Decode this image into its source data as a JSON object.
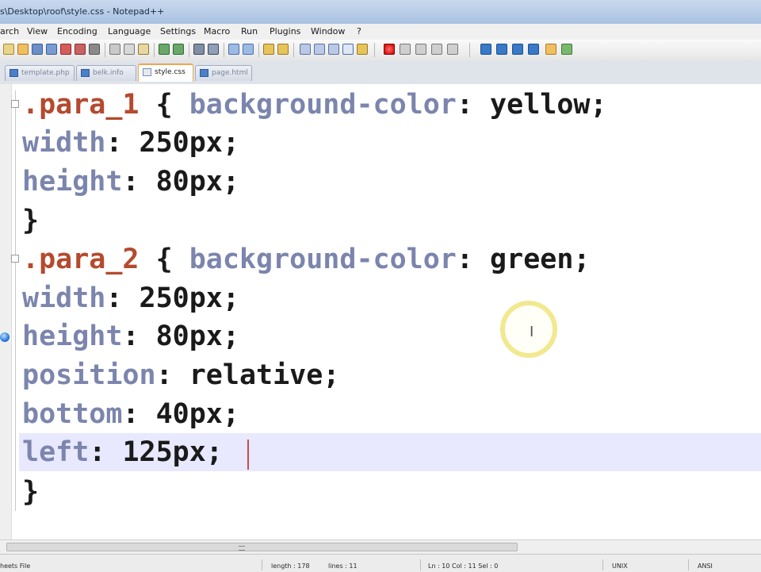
{
  "window": {
    "title": "s\\Desktop\\roof\\style.css - Notepad++"
  },
  "menubar": {
    "items": [
      "arch",
      "View",
      "Encoding",
      "Language",
      "Settings",
      "Macro",
      "Run",
      "Plugins",
      "Window",
      "?"
    ]
  },
  "tabs": [
    {
      "label": "template.php",
      "active": false
    },
    {
      "label": "belk.info",
      "active": false
    },
    {
      "label": "style.css",
      "active": true
    },
    {
      "label": "page.html",
      "active": false
    }
  ],
  "editor": {
    "lines": [
      {
        "sel": ".para_1",
        "open": " { ",
        "prop": "background-color",
        "colon": ": ",
        "val": "yellow",
        "end": ";"
      },
      {
        "prop": "width",
        "colon": ": ",
        "val": "250px",
        "end": ";"
      },
      {
        "prop": "height",
        "colon": ": ",
        "val": "80px",
        "end": ";"
      },
      {
        "brace": "}"
      },
      {
        "sel": ".para_2",
        "open": " { ",
        "prop": "background-color",
        "colon": ": ",
        "val": "green",
        "end": ";"
      },
      {
        "prop": "width",
        "colon": ": ",
        "val": "250px",
        "end": ";"
      },
      {
        "prop": "height",
        "colon": ": ",
        "val": "80px",
        "end": ";"
      },
      {
        "prop": "position",
        "colon": ": ",
        "val": "relative",
        "end": ";"
      },
      {
        "prop": "bottom",
        "colon": ": ",
        "val": "40px",
        "end": ";"
      },
      {
        "prop": "left",
        "colon": ": ",
        "val": "125px",
        "end": ";"
      },
      {
        "brace": "}"
      }
    ],
    "current_line": 10,
    "mouse_cursor_glyph": "I"
  },
  "colors": {
    "selector": "#b54a2e",
    "property": "#7b85ad",
    "value": "#1a1a1a",
    "current_line_bg": "#e8e8ff"
  },
  "statusbar": {
    "file_type": "heets File",
    "length": "length : 178",
    "lines": "lines : 11",
    "position": "Ln : 10    Col : 11    Sel : 0",
    "eol": "UNIX",
    "encoding": "ANSI"
  }
}
